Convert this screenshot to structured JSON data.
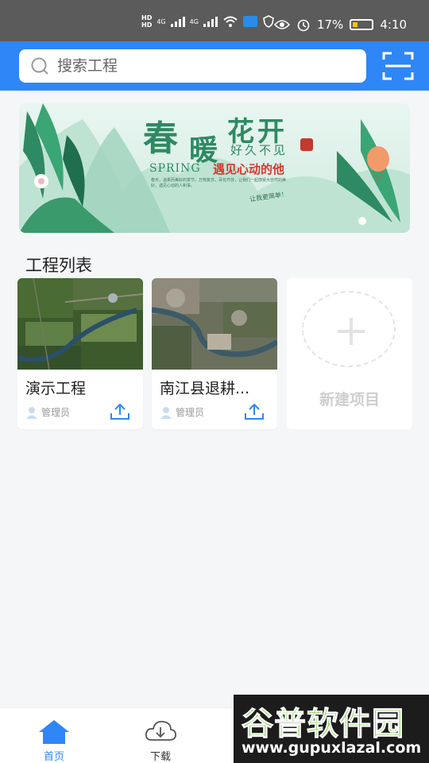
{
  "status_bar": {
    "hd_top": "HD",
    "hd_bottom": "HD",
    "network_1": "4G",
    "network_2": "4G",
    "battery_percent": "17%",
    "time": "4:10"
  },
  "search": {
    "placeholder": "搜索工程",
    "icon": "search-icon"
  },
  "scan": {
    "icon": "scan-icon"
  },
  "banner": {
    "title_1": "春",
    "title_2": "暖",
    "title_3": "花开",
    "subtitle": "好久不见",
    "spring": "SPRING",
    "slogan": "遇见心动的他",
    "tag": "让我更简单！",
    "small_text": "春天，温柔而美好的季节，万物复苏，百花齐放，让我们一起感受大自然的美好，遇见心动的人和事。",
    "accent": "#2e8a62"
  },
  "section": {
    "title": "工程列表"
  },
  "projects": [
    {
      "name": "演示工程",
      "owner": "管理员",
      "upload_icon": "upload-icon"
    },
    {
      "name": "南江县退耕...",
      "owner": "管理员",
      "upload_icon": "upload-icon"
    }
  ],
  "new_project": {
    "label": "新建项目"
  },
  "bottom_nav": {
    "items": [
      {
        "label": "首页",
        "icon": "home-icon",
        "active": true
      },
      {
        "label": "下载",
        "icon": "cloud-download-icon",
        "active": false
      }
    ]
  },
  "watermark": {
    "logo": "谷普软件园",
    "url": "www.gupuxlazal.com"
  },
  "colors": {
    "primary": "#2f86f6",
    "status_bar": "#5b5b5b"
  }
}
